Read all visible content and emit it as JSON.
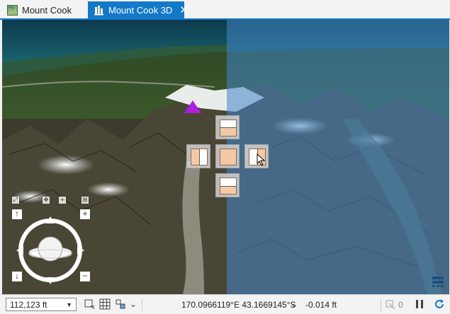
{
  "tabs": [
    {
      "label": "Mount Cook",
      "icon": "map-icon",
      "active": false
    },
    {
      "label": "Mount Cook 3D",
      "icon": "scene-icon",
      "active": true,
      "close": "✕"
    }
  ],
  "map": {
    "label_marker": "pyramid-marker-icon",
    "overlay_color": "#4287c8",
    "marker_color": "#b01ee0",
    "swipe_buttons": [
      "swipe-top-button",
      "swipe-left-button",
      "swipe-center-button",
      "swipe-right-button",
      "swipe-bottom-button"
    ],
    "navigator": {
      "up": "↑",
      "down": "↓",
      "plus": "+",
      "minus": "−"
    }
  },
  "status": {
    "scale": "112,123 ft",
    "coordinates": "170.0966119°E 43.1669145°S",
    "elevation": "-0.014 ft",
    "feature_count": "0"
  },
  "colors": {
    "accent": "#1479c9",
    "tab_active_text": "#ffffff"
  }
}
